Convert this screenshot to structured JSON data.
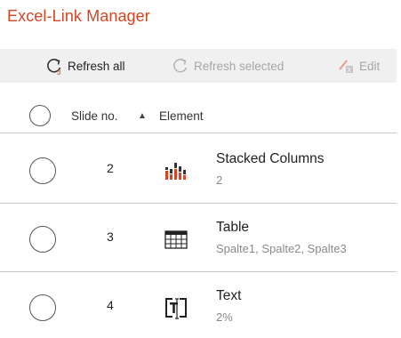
{
  "app": {
    "title": "Excel-Link Manager"
  },
  "toolbar": {
    "refresh_all": "Refresh all",
    "refresh_selected": "Refresh selected",
    "edit": "Edit"
  },
  "header": {
    "slide_no": "Slide no.",
    "sort_indicator": "▲",
    "element": "Element"
  },
  "rows": [
    {
      "slide": "2",
      "name": "Stacked Columns",
      "detail": "2",
      "icon": "stacked-columns-chart-icon"
    },
    {
      "slide": "3",
      "name": "Table",
      "detail": "Spalte1, Spalte2, Spalte3",
      "icon": "table-icon"
    },
    {
      "slide": "4",
      "name": "Text",
      "detail": "2%",
      "icon": "text-field-icon"
    }
  ],
  "colors": {
    "accent": "#d24726",
    "disabled": "#a6a6a6",
    "toolbar_bg": "#f0f0f0"
  }
}
